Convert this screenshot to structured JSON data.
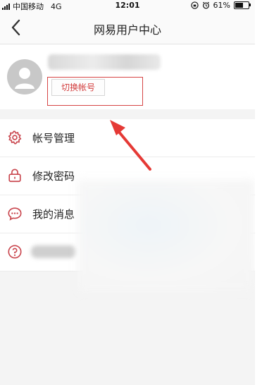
{
  "status_bar": {
    "carrier": "中国移动",
    "network": "4G",
    "time": "12:01",
    "battery": "61%",
    "battery_level": 0.61
  },
  "nav": {
    "back_icon": "chevron-left-icon",
    "title": "网易用户中心"
  },
  "profile": {
    "avatar_icon": "default-avatar-icon",
    "switch_button": "切换帐号"
  },
  "menu": {
    "items": [
      {
        "label": "帐号管理",
        "icon": "gear-icon"
      },
      {
        "label": "修改密码",
        "icon": "lock-icon"
      },
      {
        "label": "我的消息",
        "icon": "chat-bubble-icon"
      },
      {
        "label": "",
        "icon": "help-circle-icon"
      }
    ]
  },
  "colors": {
    "accent": "#d23b3b",
    "icon": "#c9464e",
    "annotation": "#e53935"
  }
}
